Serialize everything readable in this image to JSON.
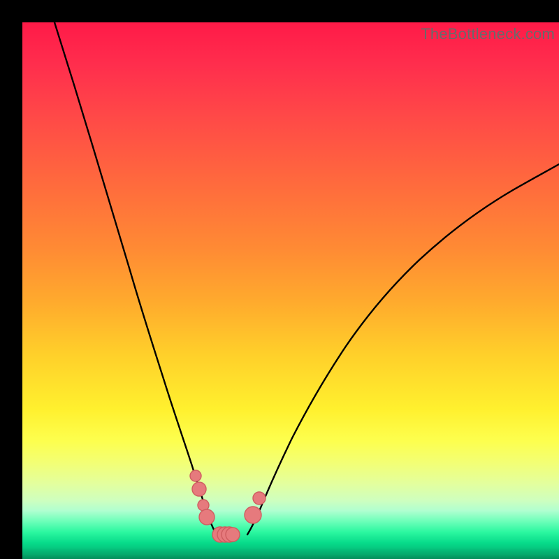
{
  "watermark": "TheBottleneck.com",
  "colors": {
    "frame": "#000000",
    "curve": "#000000",
    "marker_fill": "#e67a7d",
    "marker_stroke": "#cf5d60",
    "gradient_top": "#ff1a48",
    "gradient_bottom": "#05a96c"
  },
  "chart_data": {
    "type": "line",
    "title": "",
    "xlabel": "",
    "ylabel": "",
    "xlim": [
      0,
      100
    ],
    "ylim": [
      0,
      100
    ],
    "grid": false,
    "series": [
      {
        "name": "left-curve",
        "x": [
          6,
          8,
          10,
          12,
          14,
          16,
          18,
          20,
          22,
          24,
          26,
          28,
          30,
          31,
          32,
          33,
          34,
          34.7,
          35.3,
          36
        ],
        "y": [
          100,
          93,
          86,
          79,
          72,
          65,
          58,
          51,
          44,
          37.5,
          31,
          25,
          19,
          16,
          13.5,
          11,
          9,
          7.5,
          6,
          5
        ],
        "note": "x/y in percent of plot area; y=100 is top, y=0 is bottom"
      },
      {
        "name": "right-curve",
        "x": [
          42,
          43,
          44,
          46,
          48,
          50,
          53,
          56,
          60,
          64,
          68,
          73,
          78,
          84,
          90,
          96,
          100
        ],
        "y": [
          5,
          6.5,
          8.5,
          12,
          16,
          20,
          25.5,
          31,
          37.5,
          43.5,
          49,
          54.5,
          59.5,
          64,
          68,
          71.5,
          74
        ],
        "note": "x/y in percent of plot area; y=100 is top, y=0 is bottom"
      },
      {
        "name": "valley-markers",
        "x": [
          32.3,
          32.9,
          33.7,
          34.4,
          36.8,
          37.8,
          38.6,
          39.2,
          43.0,
          44.1
        ],
        "y": [
          15.5,
          13.0,
          10.0,
          7.8,
          4.5,
          4.5,
          4.5,
          4.5,
          8.2,
          11.3
        ],
        "radius_px": [
          8,
          10,
          8,
          11,
          11,
          11,
          11,
          10,
          12,
          9
        ]
      }
    ],
    "background_gradient_meaning": "heatmap from red (top) to green (bottom); curve minimum indicates optimal / no-bottleneck zone"
  }
}
